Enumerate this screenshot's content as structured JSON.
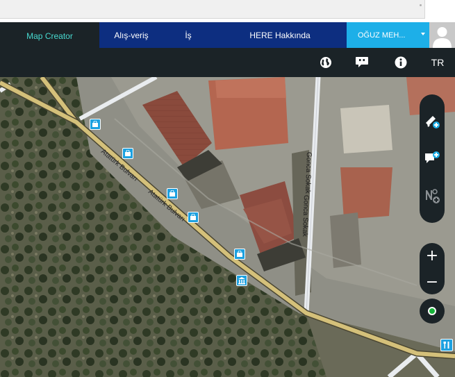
{
  "nav": {
    "items": [
      {
        "label": "Map Creator"
      },
      {
        "label": "Alış-veriş"
      },
      {
        "label": "İş"
      },
      {
        "label": "HERE Hakkında"
      }
    ],
    "user_label": "OĞUZ MEH..."
  },
  "toolbar": {
    "icons": [
      "globe-icon",
      "feedback-icon",
      "info-icon"
    ],
    "language": "TR"
  },
  "map": {
    "streets": {
      "main_road_1": "Atatürk Bulvarı",
      "main_road_2": "Atatürk Bulvarı",
      "side_street_1": "Gonca Sokak",
      "side_street_2": "Gonca Sokak"
    },
    "poi_icons": [
      "shopping-icon",
      "shopping-icon",
      "shopping-icon",
      "shopping-icon",
      "shopping-icon",
      "building-icon",
      "restaurant-icon"
    ]
  },
  "controls": {
    "tools": [
      "add-road-icon",
      "add-place-icon",
      "add-address-icon"
    ],
    "zoom_in": "+",
    "zoom_out": "−"
  },
  "colors": {
    "nav_bg": "#0d2e80",
    "active_tab_bg": "#1b2327",
    "active_tab_text": "#48dad0",
    "user_menu_bg": "#1dafe8",
    "toolbar_bg": "#1b2327",
    "poi_blue": "#1da1e0",
    "road_main": "#d4c07a",
    "locate_green": "#18b43b"
  }
}
